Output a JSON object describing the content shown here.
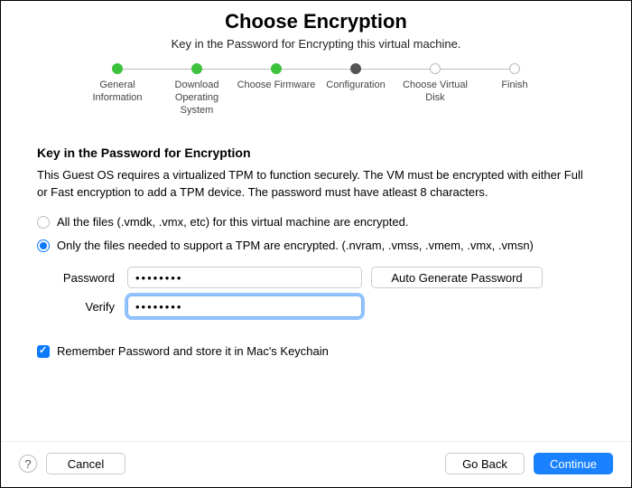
{
  "header": {
    "title": "Choose Encryption",
    "subtitle": "Key in the Password for Encrypting this virtual machine."
  },
  "steps": [
    {
      "label": "General Information",
      "state": "done"
    },
    {
      "label": "Download Operating System",
      "state": "done"
    },
    {
      "label": "Choose Firmware",
      "state": "done"
    },
    {
      "label": "Configuration",
      "state": "active"
    },
    {
      "label": "Choose Virtual Disk",
      "state": "pending"
    },
    {
      "label": "Finish",
      "state": "pending"
    }
  ],
  "section": {
    "heading": "Key in the Password for Encryption",
    "description": "This Guest OS requires a virtualized TPM to function securely. The VM must be encrypted with either Full or Fast encryption to add a TPM device. The password must have atleast 8 characters."
  },
  "options": {
    "full": {
      "label": "All the files (.vmdk, .vmx, etc) for this virtual machine are encrypted.",
      "checked": false
    },
    "partial": {
      "label": "Only the files needed to support a TPM are encrypted. (.nvram, .vmss, .vmem, .vmx, .vmsn)",
      "checked": true
    }
  },
  "password": {
    "label": "Password",
    "value": "••••••••",
    "verify_label": "Verify",
    "verify_value": "••••••••",
    "auto_button": "Auto Generate Password"
  },
  "remember": {
    "label": "Remember Password and store it in Mac's Keychain",
    "checked": true
  },
  "footer": {
    "help": "?",
    "cancel": "Cancel",
    "back": "Go Back",
    "continue": "Continue"
  }
}
